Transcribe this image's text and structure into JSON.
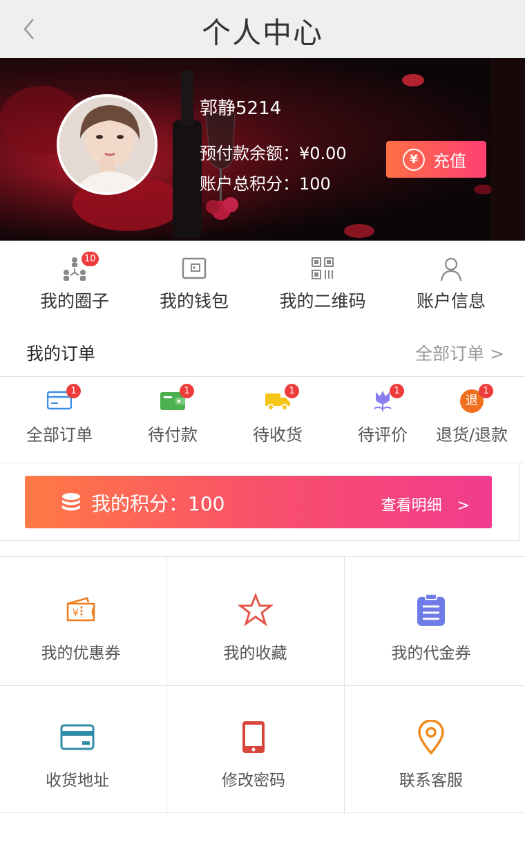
{
  "header": {
    "title": "个人中心"
  },
  "profile": {
    "username": "郭静5214",
    "balance": "预付款余额：¥0.00",
    "points": "账户总积分：100",
    "recharge_label": "充值",
    "recharge_icon": "¥"
  },
  "quick": [
    {
      "label": "我的圈子",
      "icon": "circle-network-icon",
      "badge": "10"
    },
    {
      "label": "我的钱包",
      "icon": "wallet-icon"
    },
    {
      "label": "我的二维码",
      "icon": "qrcode-icon"
    },
    {
      "label": "账户信息",
      "icon": "user-icon"
    }
  ],
  "orders": {
    "title": "我的订单",
    "all_link": "全部订单 >",
    "items": [
      {
        "label": "全部订单",
        "icon": "card-icon",
        "badge": "1",
        "color": "#3a8ee6"
      },
      {
        "label": "待付款",
        "icon": "wallet-pay-icon",
        "badge": "1",
        "color": "#4caf50"
      },
      {
        "label": "待收货",
        "icon": "truck-icon",
        "badge": "1",
        "color": "#f5c518"
      },
      {
        "label": "待评价",
        "icon": "flower-icon",
        "badge": "1",
        "color": "#8a7df0"
      },
      {
        "label": "退货/退款",
        "icon": "refund-icon",
        "badge": "1",
        "icon_text": "退",
        "color": "#f07020"
      }
    ]
  },
  "points_bar": {
    "label": "我的积分：100",
    "detail": "查看明细　>"
  },
  "grid": [
    {
      "label": "我的优惠券",
      "icon": "coupon-icon",
      "color": "#f07a1c"
    },
    {
      "label": "我的收藏",
      "icon": "star-icon",
      "color": "#e2584a"
    },
    {
      "label": "我的代金券",
      "icon": "clipboard-icon",
      "color": "#6f7ce8"
    },
    {
      "label": "收货地址",
      "icon": "address-card-icon",
      "color": "#2f8ca8"
    },
    {
      "label": "修改密码",
      "icon": "phone-icon",
      "color": "#d8453a"
    },
    {
      "label": "联系客服",
      "icon": "location-pin-icon",
      "color": "#f08a1c"
    }
  ]
}
